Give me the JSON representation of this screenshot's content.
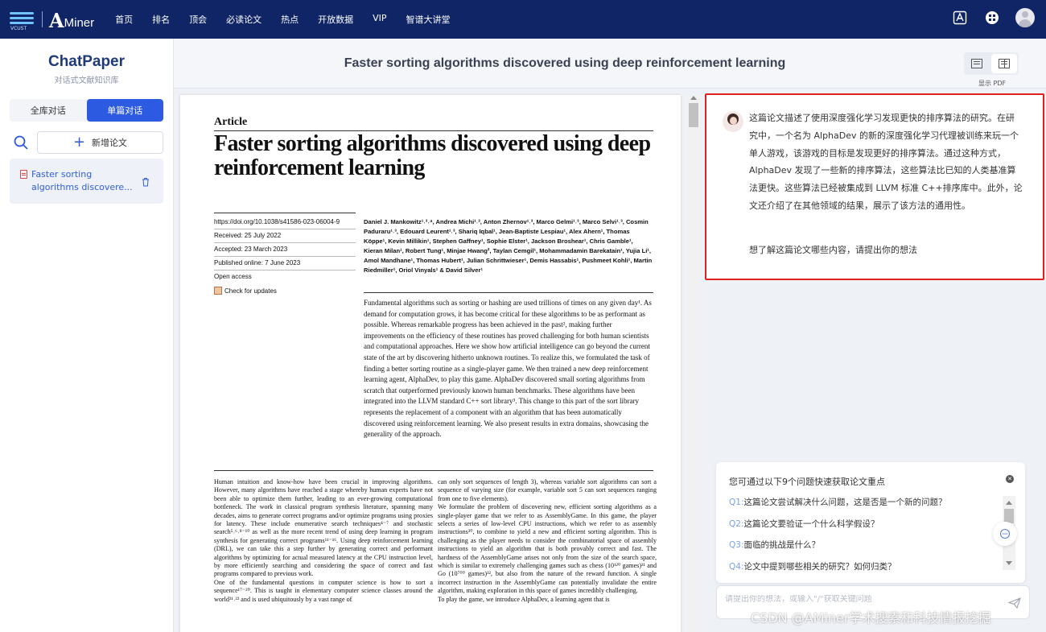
{
  "topnav": {
    "logo_small": "VCUST",
    "brand_a": "A",
    "brand_rest": "Miner",
    "items": [
      "首页",
      "排名",
      "顶会",
      "必读论文",
      "热点",
      "开放数据",
      "VIP",
      "智谱大讲堂"
    ]
  },
  "sidebar": {
    "title": "ChatPaper",
    "subtitle": "对话式文献知识库",
    "tabs": [
      "全库对话",
      "单篇对话"
    ],
    "active_tab": "单篇对话",
    "add_label": "新增论文",
    "papers": [
      {
        "label": "Faster sorting algorithms discovere..."
      }
    ]
  },
  "header": {
    "title": "Faster sorting algorithms discovered using deep reinforcement learning",
    "show_pdf": "显示 PDF"
  },
  "pdf": {
    "article_label": "Article",
    "title": "Faster sorting algorithms discovered using deep reinforcement learning",
    "meta": [
      "https://doi.org/10.1038/s41586-023-06004-9",
      "Received: 25 July 2022",
      "Accepted: 23 March 2023",
      "Published online: 7 June 2023",
      "Open access"
    ],
    "check_updates": "Check for updates",
    "authors": "Daniel J. Mankowitz¹˒³˒⁴, Andrea Michi¹˒³, Anton Zhernov¹˒³, Marco Gelmi¹˒³, Marco Selvi¹˒³, Cosmin Paduraru¹˒³, Edouard Leurent¹˒³, Shariq Iqbal¹, Jean-Baptiste Lespiau¹, Alex Ahern¹, Thomas Köppe¹, Kevin Millikin¹, Stephen Gaffney¹, Sophie Elster¹, Jackson Broshear¹, Chris Gamble¹, Kieran Milan¹, Robert Tung¹, Minjae Hwang², Taylan Cemgil¹, Mohammadamin Barekatain¹, Yujia Li¹, Amol Mandhane¹, Thomas Hubert¹, Julian Schrittwieser¹, Demis Hassabis¹, Pushmeet Kohli¹, Martin Riedmiller¹, Oriol Vinyals¹ & David Silver¹",
    "abstract": "Fundamental algorithms such as sorting or hashing are used trillions of times on any given day¹. As demand for computation grows, it has become critical for these algorithms to be as performant as possible. Whereas remarkable progress has been achieved in the past², making further improvements on the efficiency of these routines has proved challenging for both human scientists and computational approaches. Here we show how artificial intelligence can go beyond the current state of the art by discovering hitherto unknown routines. To realize this, we formulated the task of finding a better sorting routine as a single-player game. We then trained a new deep reinforcement learning agent, AlphaDev, to play this game. AlphaDev discovered small sorting algorithms from scratch that outperformed previously known human benchmarks. These algorithms have been integrated into the LLVM standard C++ sort library³. This change to this part of the sort library represents the replacement of a component with an algorithm that has been automatically discovered using reinforcement learning. We also present results in extra domains, showcasing the generality of the approach.",
    "body_left": "Human intuition and know-how have been crucial in improving algorithms. However, many algorithms have reached a stage whereby human experts have not been able to optimize them further, leading to an ever-growing computational bottleneck. The work in classical program synthesis literature, spanning many decades, aims to generate correct programs and/or optimize programs using proxies for latency. These include enumerative search techniques⁴⁻⁷ and stochastic search⁵˒⁶˒⁸⁻¹⁰ as well as the more recent trend of using deep learning in program synthesis for generating correct programs¹¹⁻¹⁶. Using deep reinforcement learning (DRL), we can take this a step further by generating correct and performant algorithms by optimizing for actual measured latency at the CPU instruction level, by more efficiently searching and considering the space of correct and fast programs compared to previous work.\n   One of the fundamental questions in computer science is how to sort a sequence¹⁷⁻²⁰. This is taught in elementary computer science classes around the world²¹˒²² and is used ubiquitously by a vast range of",
    "body_right": "can only sort sequences of length 3), whereas variable sort algorithms can sort a sequence of varying size (for example, variable sort 5 can sort sequences ranging from one to five elements).\n   We formulate the problem of discovering new, efficient sorting algorithms as a single-player game that we refer to as AssemblyGame. In this game, the player selects a series of low-level CPU instructions, which we refer to as assembly instructions³⁰, to combine to yield a new and efficient sorting algorithm. This is challenging as the player needs to consider the combinatorial space of assembly instructions to yield an algorithm that is both provably correct and fast. The hardness of the AssemblyGame arises not only from the size of the search space, which is similar to extremely challenging games such as chess (10¹²⁰ games)³¹ and Go (10⁷⁰⁰ games)³², but also from the nature of the reward function. A single incorrect instruction in the AssemblyGame can potentially invalidate the entire algorithm, making exploration in this space of games incredibly challenging.\n   To play the game, we introduce AlphaDev, a learning agent that is"
  },
  "chat": {
    "bot_message": "这篇论文描述了使用深度强化学习发现更快的排序算法的研究。在研究中，一个名为 AlphaDev 的新的深度强化学习代理被训练来玩一个单人游戏，该游戏的目标是发现更好的排序算法。通过这种方式，AlphaDev 发现了一些新的排序算法，这些算法比已知的人类基准算法更快。这些算法已经被集成到 LLVM 标准 C++排序库中。此外，论文还介绍了在其他领域的结果，展示了该方法的通用性。",
    "bot_prompt": "想了解这篇论文哪些内容，请提出你的想法",
    "questions_header": "您可通过以下9个问题快速获取论文重点",
    "questions": [
      {
        "num": "Q1:",
        "text": "这篇论文尝试解决什么问题，这是否是一个新的问题？"
      },
      {
        "num": "Q2:",
        "text": "这篇论文要验证一个什么科学假设？"
      },
      {
        "num": "Q3:",
        "text": "面临的挑战是什么？"
      },
      {
        "num": "Q4:",
        "text": "论文中提到哪些相关的研究？如何归类？"
      }
    ],
    "input_placeholder": "请提出你的想法，或输入\"/\"获取关键问题"
  },
  "watermark": "CSDN @AMiner学术搜索和科技情报挖掘",
  "colors": {
    "topbar": "#0f2566",
    "accent": "#2c5ae0",
    "highlight_border": "#e02020"
  }
}
